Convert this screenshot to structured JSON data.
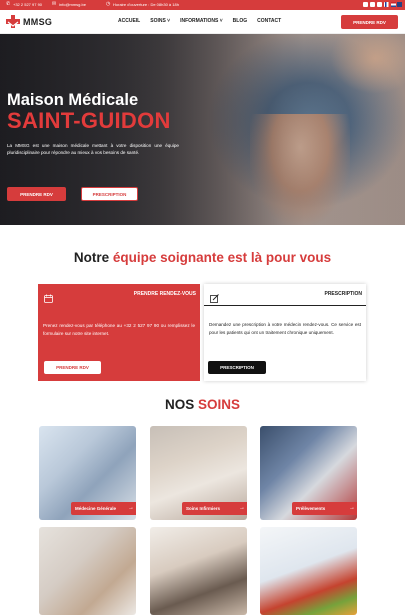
{
  "topbar": {
    "phone": "+32 2 527 97 90",
    "email": "info@mmsg.be",
    "hours": "Horaire d'ouverture : De 08h30 à 18h"
  },
  "nav": {
    "logo": "MMSG",
    "menu": [
      "ACCUEIL",
      "SOINS",
      "INFORMATIONS",
      "BLOG",
      "CONTACT"
    ],
    "cta": "PRENDRE RDV"
  },
  "hero": {
    "title": "Maison Médicale",
    "subtitle": "SAINT-GUIDON",
    "description": "La MMSG est une maison médicale mettant à votre disposition une équipe pluridisciplinaire pour répondre au mieux à vos besoins de santé.",
    "primary_button": "PRENDRE RDV",
    "secondary_button": "PRESCRIPTION"
  },
  "team": {
    "title_prefix": "Notre ",
    "title_highlight": "équipe soignante est là pour vous"
  },
  "cards": {
    "rdv": {
      "title": "PRENDRE RENDEZ-VOUS",
      "text": "Prenez rendez-vous par téléphone au +32 2 527 97 90 ou remplissez le formulaire sur notre site internet.",
      "button": "PRENDRE RDV"
    },
    "prescription": {
      "title": "PRESCRIPTION",
      "text": "Demandez une prescription à votre médecin rendez-vous. Ce service est pour les patients qui ont un traitement chronique uniquement.",
      "button": "PRESCRIPTION"
    }
  },
  "soins": {
    "title_prefix": "NOS ",
    "title_highlight": "SOINS",
    "items": [
      "Médecine Générale",
      "Soins Infirmiers",
      "Prélèvements"
    ]
  },
  "colors": {
    "accent": "#d63c3c",
    "dark": "#111111"
  }
}
